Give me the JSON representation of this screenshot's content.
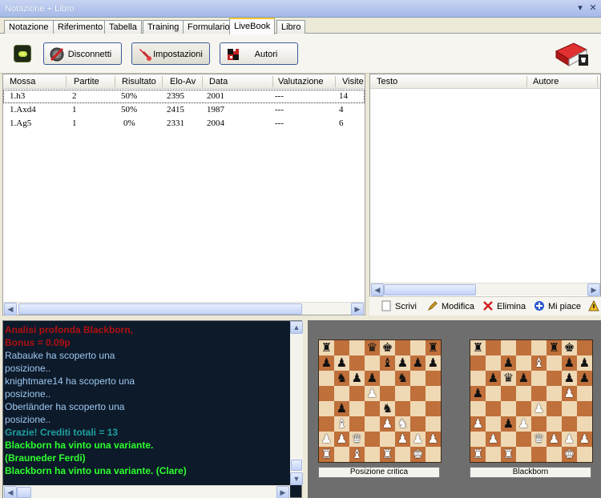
{
  "window": {
    "title": "Notazione + Libro"
  },
  "tabs": [
    "Notazione",
    "Riferimento",
    "Tabella",
    "Training",
    "Formulario",
    "LiveBook",
    "Libro"
  ],
  "active_tab": "LiveBook",
  "toolbar": {
    "disconnect_label": "Disconnetti",
    "settings_label": "Impostazioni",
    "authors_label": "Autori"
  },
  "moves_table": {
    "columns": [
      "Mossa",
      "Partite",
      "Risultato",
      "Elo-Av",
      "Data",
      "Valutazione",
      "Visite"
    ],
    "rows": [
      {
        "mossa": "1.h3",
        "partite": "2",
        "risultato": "50%",
        "elo": "2395",
        "data": "2001",
        "valutazione": "---",
        "visite": "14"
      },
      {
        "mossa": "1.Axd4",
        "partite": "1",
        "risultato": "50%",
        "elo": "2415",
        "data": "1987",
        "valutazione": "---",
        "visite": "4"
      },
      {
        "mossa": "1.Ag5",
        "partite": "1",
        "risultato": "0%",
        "elo": "2331",
        "data": "2004",
        "valutazione": "---",
        "visite": "6"
      }
    ]
  },
  "comments_table": {
    "columns": [
      "Testo",
      "Autore"
    ]
  },
  "comment_tools": {
    "write_label": "Scrivi",
    "edit_label": "Modifica",
    "delete_label": "Elimina",
    "like_label": "Mi piace"
  },
  "log": [
    {
      "text": "Analisi profonda Blackborn,",
      "color": "#b01010"
    },
    {
      "text": "Bonus = 0.09p",
      "color": "#b01010"
    },
    {
      "text": "Rabauke ha scoperto una",
      "color": "#9ec8f0"
    },
    {
      "text": "posizione..",
      "color": "#9ec8f0"
    },
    {
      "text": "knightmare14 ha scoperto una",
      "color": "#9ec8f0"
    },
    {
      "text": "posizione..",
      "color": "#9ec8f0"
    },
    {
      "text": "Oberländer ha scoperto una",
      "color": "#9ec8f0"
    },
    {
      "text": "posizione..",
      "color": "#9ec8f0"
    },
    {
      "text": "Grazie! Crediti totali = 13",
      "color": "#1fa0a0"
    },
    {
      "text": "Blackborn ha vinto una variante.",
      "color": "#2cff2c"
    },
    {
      "text": "(Brauneder Ferdi)",
      "color": "#2cff2c"
    },
    {
      "text": "Blackborn ha vinto una variante. (Clare)",
      "color": "#2cff2c"
    }
  ],
  "boards": [
    {
      "label": "Posizione critica",
      "rows": [
        "r..qk..r",
        "pp..bppp",
        ".npp.n..",
        "...P....",
        ".p..n...",
        ".B..PN..",
        "PPQ..PPP",
        "R.B.R.K."
      ]
    },
    {
      "label": "Blackborn",
      "rows": [
        "r....rk.",
        "..p.B.pp",
        ".pqp..pp",
        "p.....P.",
        "....P...",
        "P.pP....",
        ".P..QPPP",
        "R.R...K."
      ]
    }
  ]
}
